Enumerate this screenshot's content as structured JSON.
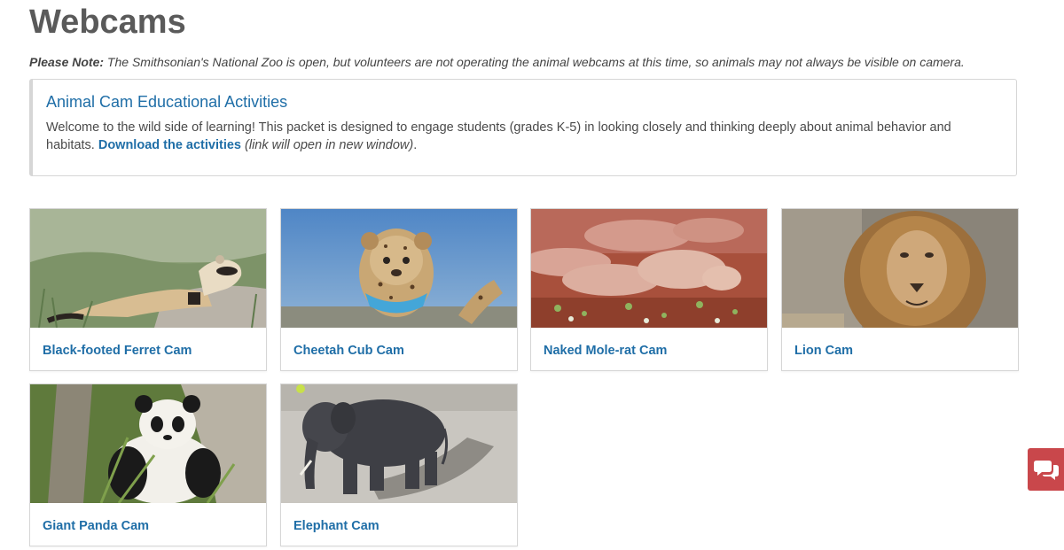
{
  "page": {
    "title": "Webcams"
  },
  "note": {
    "label": "Please Note:",
    "text": " The Smithsonian's National Zoo is open, but volunteers are not operating the animal webcams at this time, so animals may not always be visible on camera."
  },
  "activities": {
    "title": "Animal Cam Educational Activities",
    "text": "Welcome to the wild side of learning! This packet is designed to engage students (grades K-5) in looking closely and thinking deeply about animal behavior and habitats. ",
    "link_label": "Download the activities",
    "link_note": " (link will open in new window)",
    "end": "."
  },
  "cams": [
    {
      "label": "Black-footed Ferret Cam",
      "image": "ferret-photo"
    },
    {
      "label": "Cheetah Cub Cam",
      "image": "cheetah-cub-photo"
    },
    {
      "label": "Naked Mole-rat Cam",
      "image": "naked-mole-rat-photo"
    },
    {
      "label": "Lion Cam",
      "image": "lion-photo"
    },
    {
      "label": "Giant Panda Cam",
      "image": "giant-panda-photo"
    },
    {
      "label": "Elephant Cam",
      "image": "elephant-photo"
    }
  ],
  "chat": {
    "icon": "chat-bubbles-icon",
    "color": "#c9474b"
  },
  "colors": {
    "link": "#1f6ea7",
    "heading": "#5a5a5a"
  }
}
